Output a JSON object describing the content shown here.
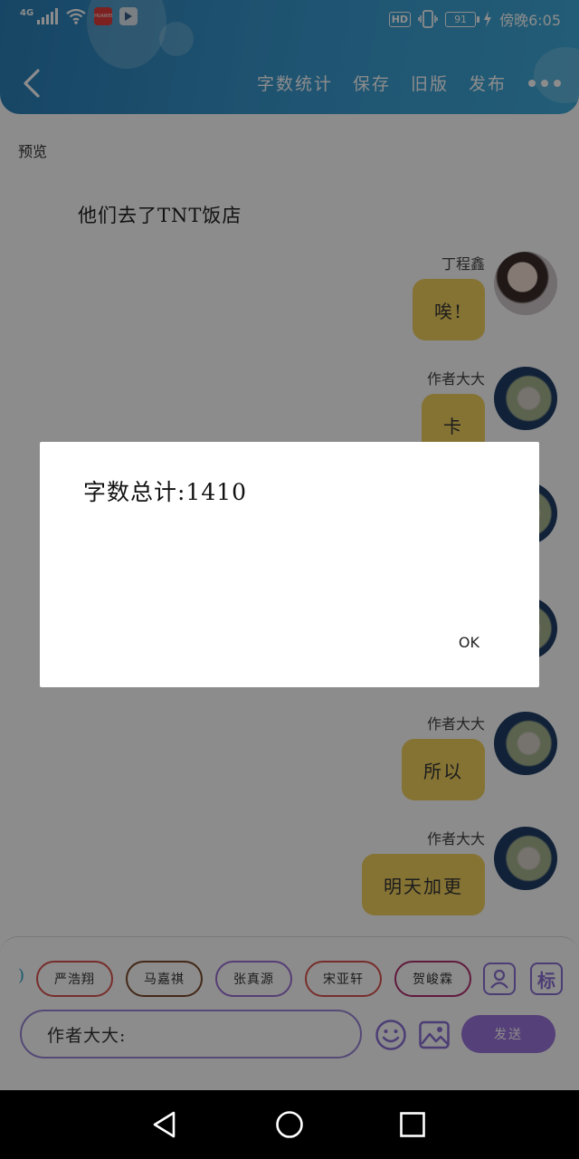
{
  "status_bar": {
    "network": "4G",
    "hd_label": "HD",
    "battery": "91",
    "time": "傍晚6:05",
    "huawei_badge_color": "#e23b3b"
  },
  "header": {
    "actions": [
      {
        "label": "字数统计"
      },
      {
        "label": "保存"
      },
      {
        "label": "旧版"
      },
      {
        "label": "发布"
      }
    ]
  },
  "chat": {
    "prev_label": "预览",
    "narration": "他们去了TNT饭店",
    "messages": [
      {
        "name": "丁程鑫",
        "text": "唉!"
      },
      {
        "name": "作者大大",
        "text": "卡"
      },
      {
        "name": "作者大大",
        "text": "所以"
      },
      {
        "name": "作者大大",
        "text": "明天加更"
      }
    ]
  },
  "input_panel": {
    "characters": [
      {
        "label": "严浩翔",
        "color": "#d9534f"
      },
      {
        "label": "马嘉祺",
        "color": "#7a4a2a"
      },
      {
        "label": "张真源",
        "color": "#9b6fd6"
      },
      {
        "label": "宋亚轩",
        "color": "#d9534f"
      },
      {
        "label": "贺峻霖",
        "color": "#b03070"
      }
    ],
    "side_label_icon": "标",
    "input_value": "作者大大:",
    "send_label": "发送"
  },
  "dialog": {
    "message": "字数总计:1410",
    "ok_label": "OK"
  },
  "colors": {
    "header": "#3a9bd0",
    "bubble": "#f2d160",
    "accent": "#9b75dc"
  }
}
